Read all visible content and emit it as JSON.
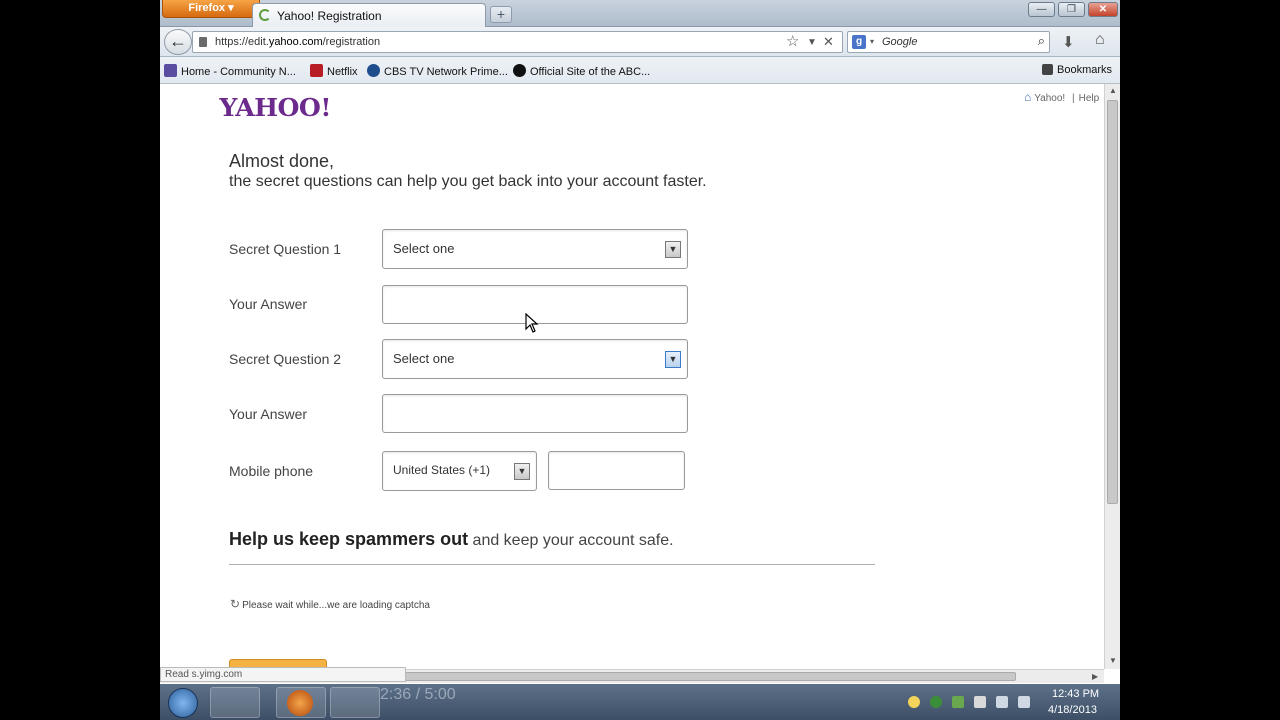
{
  "browser": {
    "menu_button": "Firefox ▾",
    "tab_title": "Yahoo! Registration",
    "new_tab": "+",
    "url_prefix": "https://edit.",
    "url_domain": "yahoo.com",
    "url_path": "/registration",
    "search_engine": "Google",
    "window_controls": {
      "minimize": "—",
      "maximize": "❐",
      "close": "✕"
    },
    "icons": [
      "back-icon",
      "lock-icon",
      "star-icon",
      "dropdown-icon",
      "stop-icon",
      "search-icon",
      "download-icon",
      "home-icon"
    ]
  },
  "bookmarks": {
    "items": [
      {
        "label": "Home - Community N...",
        "icon_color": "#5b4ea0"
      },
      {
        "label": "Netflix",
        "icon_color": "#b81d24"
      },
      {
        "label": "CBS TV Network Prime...",
        "icon_color": "#1f4e8c"
      },
      {
        "label": "Official Site of the ABC...",
        "icon_color": "#111111"
      }
    ],
    "bookmarks_label": "Bookmarks"
  },
  "page": {
    "logo": "YAHOO!",
    "top_links": {
      "yahoo": "Yahoo!",
      "separator": "|",
      "help": "Help"
    },
    "heading": "Almost done,",
    "subheading": "the secret questions can help you get back into your account faster.",
    "fields": {
      "q1_label": "Secret Question 1",
      "q1_value": "Select one",
      "a1_label": "Your Answer",
      "q2_label": "Secret Question 2",
      "q2_value": "Select one",
      "a2_label": "Your Answer",
      "mobile_label": "Mobile phone",
      "country_value": "United States (+1)"
    },
    "spam_heading_bold": "Help us keep spammers out",
    "spam_heading_rest": " and keep your account safe.",
    "captcha_wait": "Please wait while...we are loading captcha"
  },
  "status": {
    "text": "Read s.yimg.com"
  },
  "taskbar": {
    "video_time": "2:36 / 5:00",
    "clock_time": "12:43 PM",
    "clock_date": "4/18/2013"
  },
  "colors": {
    "yahoo_purple": "#6d2a8d",
    "firefox_orange": "#e27d1e",
    "submit_orange": "#f5b244"
  }
}
